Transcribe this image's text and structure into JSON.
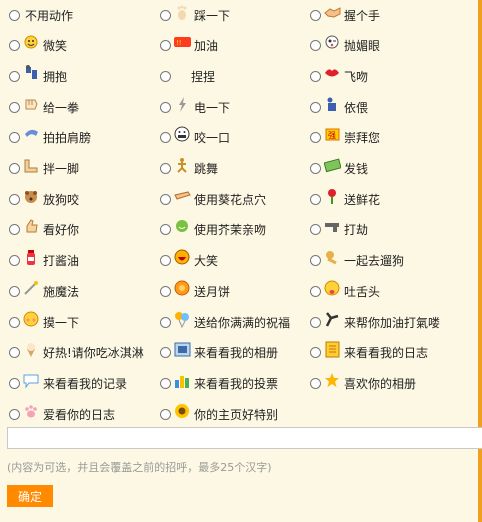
{
  "actions": [
    [
      {
        "label": "不用动作",
        "icon": "none"
      },
      {
        "label": "踩一下",
        "icon": "footprint-icon"
      },
      {
        "label": "握个手",
        "icon": "handshake-icon"
      }
    ],
    [
      {
        "label": "微笑",
        "icon": "smile-icon"
      },
      {
        "label": "加油",
        "icon": "cheer-banner-icon"
      },
      {
        "label": "抛媚眼",
        "icon": "wink-face-icon"
      }
    ],
    [
      {
        "label": "拥抱",
        "icon": "hug-icon"
      },
      {
        "label": "捏捏",
        "icon": "pinch-icon"
      },
      {
        "label": "飞吻",
        "icon": "lips-icon"
      }
    ],
    [
      {
        "label": "给一拳",
        "icon": "fist-icon"
      },
      {
        "label": "电一下",
        "icon": "lightning-icon"
      },
      {
        "label": "依偎",
        "icon": "snuggle-icon"
      }
    ],
    [
      {
        "label": "拍拍肩膀",
        "icon": "pat-shoulder-icon"
      },
      {
        "label": "咬一口",
        "icon": "bite-face-icon"
      },
      {
        "label": "崇拜您",
        "icon": "worship-icon"
      }
    ],
    [
      {
        "label": "拌一脚",
        "icon": "trip-foot-icon"
      },
      {
        "label": "跳舞",
        "icon": "dance-icon"
      },
      {
        "label": "发钱",
        "icon": "money-icon"
      }
    ],
    [
      {
        "label": "放狗咬",
        "icon": "dog-icon"
      },
      {
        "label": "使用葵花点穴",
        "icon": "acupoint-hand-icon"
      },
      {
        "label": "送鲜花",
        "icon": "flower-icon"
      }
    ],
    [
      {
        "label": "看好你",
        "icon": "thumbs-up-icon"
      },
      {
        "label": "使用芥茉亲吻",
        "icon": "wasabi-kiss-icon"
      },
      {
        "label": "打劫",
        "icon": "gun-icon"
      }
    ],
    [
      {
        "label": "打酱油",
        "icon": "soy-bottle-icon"
      },
      {
        "label": "大笑",
        "icon": "laugh-face-icon"
      },
      {
        "label": "一起去遛狗",
        "icon": "walk-dog-icon"
      }
    ],
    [
      {
        "label": "施魔法",
        "icon": "magic-wand-icon"
      },
      {
        "label": "送月饼",
        "icon": "mooncake-icon"
      },
      {
        "label": "吐舌头",
        "icon": "tongue-face-icon"
      }
    ],
    [
      {
        "label": "摸一下",
        "icon": "touch-face-icon"
      },
      {
        "label": "送给你满满的祝福",
        "icon": "balloons-icon"
      },
      {
        "label": "来帮你加油打氣喽",
        "icon": "pump-icon"
      }
    ],
    [
      {
        "label": "好热!请你吃冰淇淋",
        "icon": "ice-cream-icon"
      },
      {
        "label": "来看看我的相册",
        "icon": "photo-frame-icon"
      },
      {
        "label": "来看看我的日志",
        "icon": "notebook-icon"
      }
    ],
    [
      {
        "label": "来看看我的记录",
        "icon": "speech-bubble-icon"
      },
      {
        "label": "来看看我的投票",
        "icon": "bar-chart-icon"
      },
      {
        "label": "喜欢你的相册",
        "icon": "star-icon"
      }
    ],
    [
      {
        "label": "爱看你的日志",
        "icon": "paw-icon"
      },
      {
        "label": "你的主页好特别",
        "icon": "sunflower-icon"
      },
      null
    ]
  ],
  "message": {
    "value": "",
    "hint": "(内容为可选，并且会覆盖之前的招呼，最多25个汉字)"
  },
  "submit_label": "确定",
  "colors": {
    "background": "#fdf8e4",
    "accent": "#ff8a00",
    "edge_bar": "#f0a020"
  }
}
